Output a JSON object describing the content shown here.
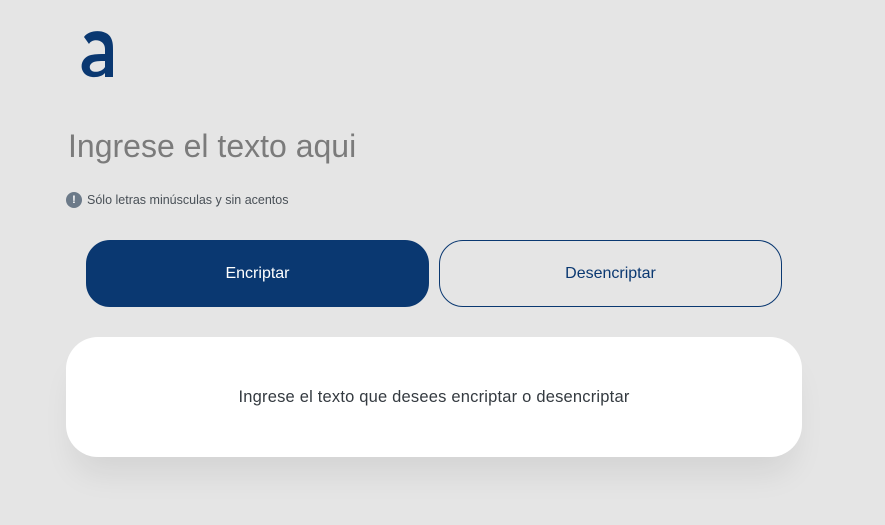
{
  "logo": {
    "icon": "alura-a-logo-icon",
    "color": "#0a3871"
  },
  "input": {
    "placeholder": "Ingrese el texto aqui",
    "value": ""
  },
  "hint": {
    "icon": "exclamation-circle-icon",
    "icon_glyph": "!",
    "text": "Sólo letras minúsculas y sin acentos"
  },
  "buttons": {
    "encrypt_label": "Encriptar",
    "decrypt_label": "Desencriptar"
  },
  "output": {
    "message": "Ingrese el texto que desees encriptar o desencriptar"
  },
  "colors": {
    "background": "#e5e5e5",
    "primary": "#0a3871",
    "placeholder": "#7b7b7b",
    "card": "#ffffff"
  }
}
